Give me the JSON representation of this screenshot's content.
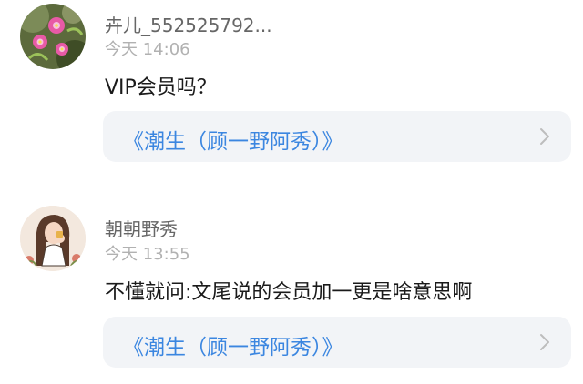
{
  "comments": [
    {
      "username": "卉儿_552525792...",
      "time": "今天 14:06",
      "text": "VIP会员吗？",
      "book_link": "《潮生（顾一野阿秀）》",
      "avatar_icon": "flower-photo-icon"
    },
    {
      "username": "朝朝野秀",
      "time": "今天 13:55",
      "text": "不懂就问:文尾说的会员加一更是啥意思啊",
      "book_link": "《潮生（顾一野阿秀）》",
      "avatar_icon": "girl-illustration-icon"
    }
  ],
  "colors": {
    "link": "#3b86e0",
    "card_bg": "#f2f4f7",
    "username": "#666666",
    "time": "#b1b1b1"
  }
}
